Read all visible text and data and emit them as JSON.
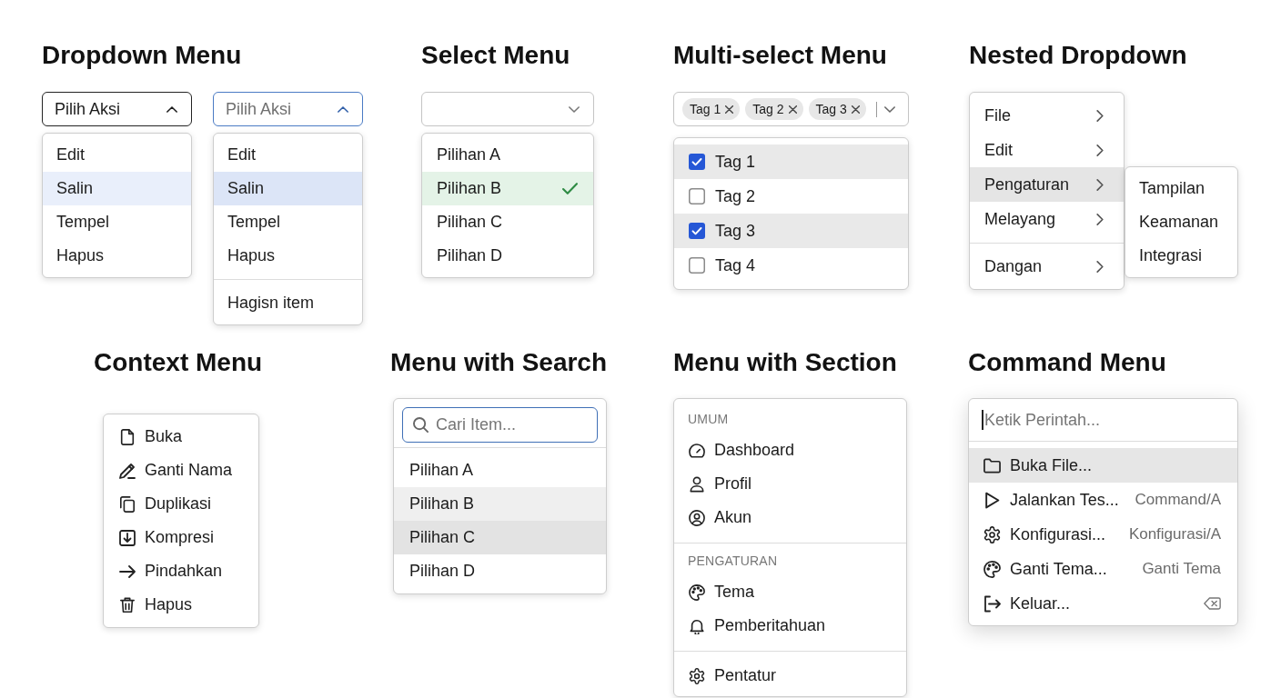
{
  "dropdown_menu": {
    "title": "Dropdown Menu",
    "variants": [
      {
        "trigger": {
          "label": "Pilih Aksi",
          "expanded": true,
          "focused": false
        },
        "items": [
          {
            "label": "Edit",
            "selected": false,
            "divider_before": false
          },
          {
            "label": "Salin",
            "selected": true,
            "divider_before": false
          },
          {
            "label": "Tempel",
            "selected": false,
            "divider_before": false
          },
          {
            "label": "Hapus",
            "selected": false,
            "divider_before": false
          }
        ]
      },
      {
        "trigger": {
          "label": "Pilih Aksi",
          "expanded": true,
          "focused": true
        },
        "items": [
          {
            "label": "Edit",
            "selected": false,
            "divider_before": false
          },
          {
            "label": "Salin",
            "selected": true,
            "divider_before": false
          },
          {
            "label": "Tempel",
            "selected": false,
            "divider_before": false
          },
          {
            "label": "Hapus",
            "selected": false,
            "divider_before": false
          },
          {
            "label": "Hagisn item",
            "selected": false,
            "divider_before": true
          }
        ]
      }
    ]
  },
  "select_menu": {
    "title": "Select Menu",
    "trigger": {
      "expanded": false
    },
    "options": [
      {
        "label": "Pilihan A",
        "selected": false
      },
      {
        "label": "Pilihan B",
        "selected": true
      },
      {
        "label": "Pilihan C",
        "selected": false
      },
      {
        "label": "Pilihan D",
        "selected": false
      }
    ]
  },
  "multi_select_menu": {
    "title": "Multi-select Menu",
    "chips": [
      {
        "label": "Tag 1"
      },
      {
        "label": "Tag 2"
      },
      {
        "label": "Tag 3"
      }
    ],
    "trigger": {
      "expanded": false
    },
    "options": [
      {
        "label": "Tag 1",
        "checked": true
      },
      {
        "label": "Tag 2",
        "checked": false
      },
      {
        "label": "Tag 3",
        "checked": true
      },
      {
        "label": "Tag 4",
        "checked": false
      }
    ]
  },
  "nested_dropdown": {
    "title": "Nested Dropdown",
    "items": [
      {
        "label": "File",
        "expanded": false,
        "divider_before": false
      },
      {
        "label": "Edit",
        "expanded": false,
        "divider_before": false
      },
      {
        "label": "Pengaturan",
        "expanded": true,
        "divider_before": false,
        "children": [
          {
            "label": "Tampilan"
          },
          {
            "label": "Keamanan"
          },
          {
            "label": "Integrasi"
          }
        ]
      },
      {
        "label": "Melayang",
        "expanded": false,
        "divider_before": false
      },
      {
        "label": "Dangan",
        "expanded": false,
        "divider_before": true
      }
    ]
  },
  "context_menu": {
    "title": "Context Menu",
    "items": [
      {
        "label": "Buka"
      },
      {
        "label": "Ganti Nama"
      },
      {
        "label": "Duplikasi"
      },
      {
        "label": "Kompresi"
      },
      {
        "label": "Pindahkan"
      },
      {
        "label": "Hapus"
      }
    ]
  },
  "menu_with_search": {
    "title": "Menu with Search",
    "search": {
      "placeholder": "Cari Item..."
    },
    "items": [
      {
        "label": "Pilihan A",
        "hovered": false,
        "selected": false
      },
      {
        "label": "Pilihan B",
        "hovered": true,
        "selected": false
      },
      {
        "label": "Pilihan C",
        "hovered": false,
        "selected": true
      },
      {
        "label": "Pilihan D",
        "hovered": false,
        "selected": false
      }
    ]
  },
  "menu_with_section": {
    "title": "Menu with Section",
    "sections": [
      {
        "title": "UMUM",
        "items": [
          {
            "label": "Dashboard"
          },
          {
            "label": "Profil"
          },
          {
            "label": "Akun"
          }
        ]
      },
      {
        "title": "PENGATURAN",
        "items": [
          {
            "label": "Tema"
          },
          {
            "label": "Pemberitahuan"
          }
        ]
      },
      {
        "items": [
          {
            "label": "Pentatur"
          }
        ]
      }
    ]
  },
  "command_menu": {
    "title": "Command Menu",
    "input": {
      "placeholder": "Ketik Perintah...",
      "focused": true
    },
    "items": [
      {
        "label": "Buka File...",
        "selected": true
      },
      {
        "label": "Jalankan Tes...",
        "shortcut": "Command/A",
        "selected": false
      },
      {
        "label": "Konfigurasi...",
        "shortcut": "Konfigurasi/A",
        "selected": false
      },
      {
        "label": "Ganti Tema...",
        "shortcut": "Ganti Tema",
        "selected": false
      },
      {
        "label": "Keluar...",
        "selected": false
      }
    ]
  }
}
